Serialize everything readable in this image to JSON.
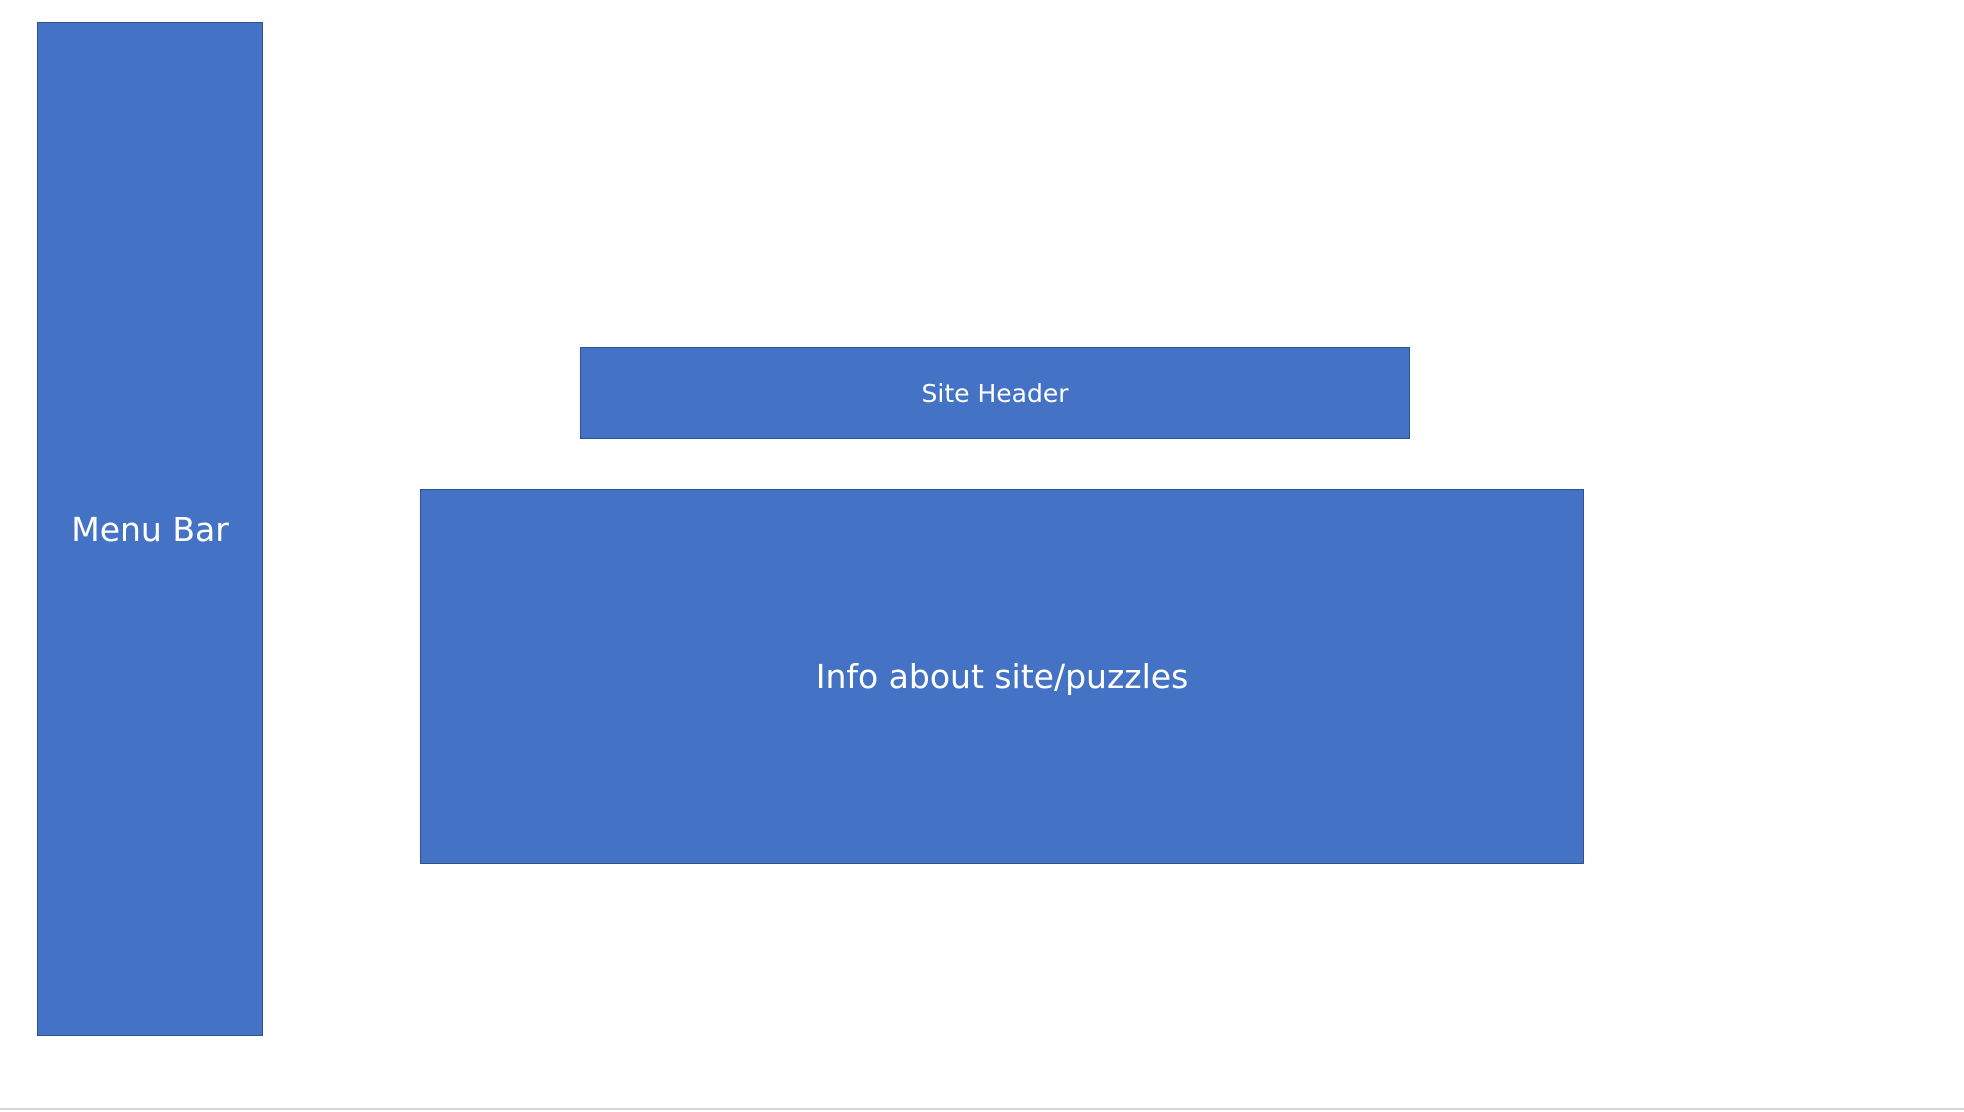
{
  "diagram": {
    "menu_bar": {
      "label": "Menu Bar"
    },
    "site_header": {
      "label": "Site Header"
    },
    "info_box": {
      "label": "Info about site/puzzles"
    }
  },
  "colors": {
    "box_fill": "#4472c4",
    "box_border": "#2f528f",
    "text": "#ffffff",
    "background": "#ffffff"
  }
}
